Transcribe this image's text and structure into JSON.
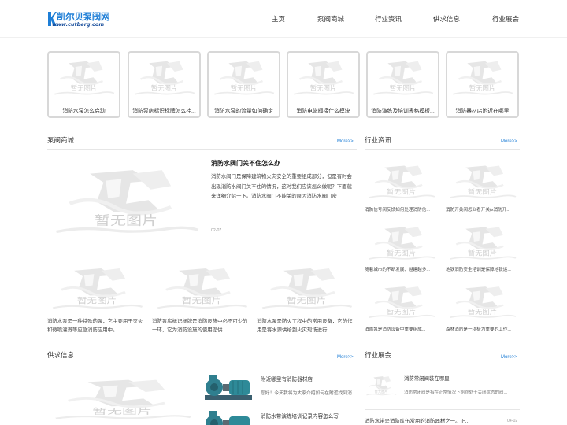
{
  "header": {
    "logo_title": "凯尔贝泵阀网",
    "logo_url": "www.cutberg.com",
    "nav": [
      "主页",
      "泵阀商城",
      "行业资讯",
      "供求信息",
      "行业展会"
    ]
  },
  "placeholder_text": "暂无图片",
  "top_strip": [
    "消防水泵怎么启动",
    "消防泵房标识标牌怎么挂...",
    "消防水泵的流量如何确定",
    "消防电磁阀接什么模块",
    "消防演练及培训表格模板...",
    "消防器材店附近在哪里"
  ],
  "shop": {
    "title": "泵阀商城",
    "more": "More>>",
    "featured": {
      "title": "消防水阀门关不住怎么办",
      "desc": "消防水阀门是保障建筑物火灾安全的重要组成部分，但是有时会出现消防水阀门关不住的情况，这时我们应该怎么做呢？下面就来详细介绍一下。消防水阀门不能关的原因消防水阀门密",
      "date": "02-07"
    },
    "items": [
      "消防水泵是一种特殊的泵，它主要用于灭火和微喷灌溉等应急消防应用中。...",
      "消防泵房标识标牌是消防设施中必不可少的一环，它为消防设施的使用提供...",
      "消防水泵是防火工程中的常用设备，它的作用是将水源供给到火灾现场进行..."
    ]
  },
  "news": {
    "title": "行业资讯",
    "more": "More>>",
    "items": [
      "消防信号阀反馈如何处理消防信...",
      "消防开关阀怎么看开关(x消防开...",
      "随着城市的不断发展、越建越多...",
      "地铁消防安全培训是保障地铁运...",
      "消防泵是消防设备中重要组成...",
      "森林消防是一项极为重要的工作..."
    ]
  },
  "supply": {
    "title": "供求信息",
    "more": "More>>",
    "items": [
      {
        "title": "附近哪里有消防器材店",
        "desc": "您好！今天我将为大家介绍如何在附近找到消防器材店"
      },
      {
        "title": "消防水带演练培训记录内容怎么写",
        "desc": ""
      }
    ]
  },
  "expo": {
    "title": "行业展会",
    "more": "More>>",
    "featured": {
      "title": "消防常闭阀装在哪里",
      "desc": "消防常闭阀是指在正常情况下始终处于关闭状态的阀..."
    },
    "item": {
      "title": "消防水带是消防队伍常用的消防器材之一。正...",
      "date": "04-02"
    }
  }
}
